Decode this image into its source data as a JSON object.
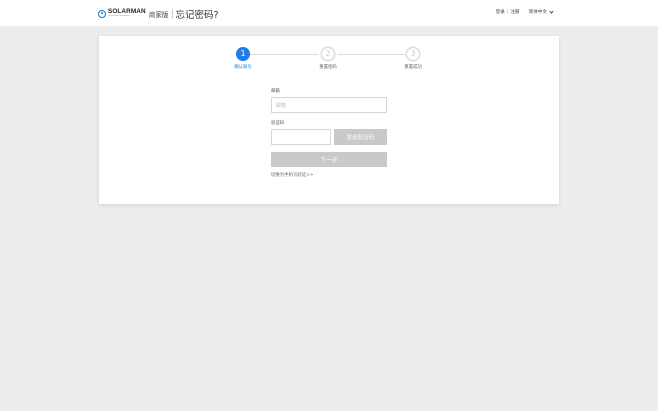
{
  "header": {
    "logo_text": "SOLARMAN",
    "logo_tagline": "Smart Energy Management",
    "edition": "商家版",
    "page_title": "忘记密码?",
    "login_label": "登录",
    "separator": "|",
    "register_label": "注册",
    "language": "简体中文"
  },
  "steps": [
    {
      "number": "1",
      "label": "确认账号",
      "state": "active"
    },
    {
      "number": "2",
      "label": "重置密码",
      "state": "inactive"
    },
    {
      "number": "3",
      "label": "重置成功",
      "state": "inactive"
    }
  ],
  "form": {
    "email_label": "邮箱",
    "email_placeholder": "邮箱",
    "code_label": "验证码",
    "code_value": "",
    "send_code_label": "发送验证码",
    "next_label": "下一步",
    "switch_link": "切换为手机号验证>>"
  },
  "colors": {
    "accent": "#1f7de3",
    "background": "#ededed",
    "disabled_button": "#c9c9c9"
  }
}
